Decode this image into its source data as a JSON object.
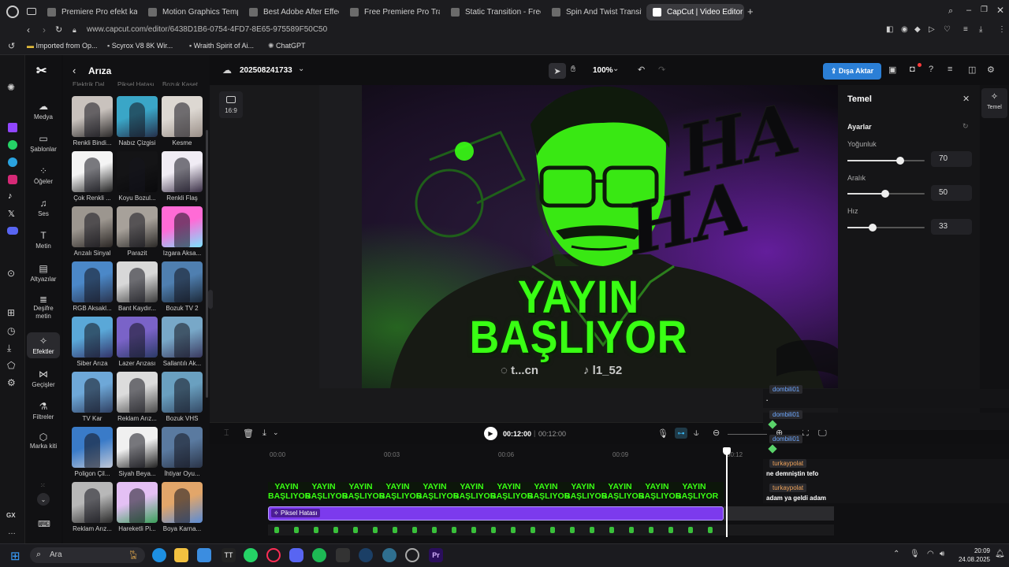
{
  "browser": {
    "tabs": [
      {
        "label": "Premiere Pro efekt kaynak"
      },
      {
        "label": "Motion Graphics Templat"
      },
      {
        "label": "Best Adobe After Effects"
      },
      {
        "label": "Free Premiere Pro Transit"
      },
      {
        "label": "Static Transition - Free P"
      },
      {
        "label": "Spin And Twist Transition"
      },
      {
        "label": "CapCut | Video Editor | Al"
      }
    ],
    "url": "www.capcut.com/editor/6438D1B6-0754-4FD7-8E65-975589F50C50",
    "bookmarks": [
      {
        "label": "Imported from Op..."
      },
      {
        "label": "Scyrox V8 8K Wir..."
      },
      {
        "label": "Wraith Spirit of Ai..."
      },
      {
        "label": "ChatGPT"
      }
    ]
  },
  "nav": {
    "items": [
      {
        "label": "Medya",
        "icon": "cloud-upload-icon"
      },
      {
        "label": "Şablonlar",
        "icon": "template-icon"
      },
      {
        "label": "Öğeler",
        "icon": "elements-icon"
      },
      {
        "label": "Ses",
        "icon": "music-icon"
      },
      {
        "label": "Metin",
        "icon": "text-icon"
      },
      {
        "label": "Altyazılar",
        "icon": "captions-icon"
      },
      {
        "label": "Deşifre metin",
        "icon": "transcript-icon"
      },
      {
        "label": "Efektler",
        "icon": "effects-icon"
      },
      {
        "label": "Geçişler",
        "icon": "transitions-icon"
      },
      {
        "label": "Filtreler",
        "icon": "filters-icon"
      },
      {
        "label": "Marka kiti",
        "icon": "brand-kit-icon"
      }
    ]
  },
  "panel": {
    "title": "Arıza",
    "top_partial_labels": [
      "Elektrik Dal...",
      "Piksel Hatası",
      "Bozuk Kaset"
    ],
    "effects": [
      {
        "label": "Renkli Bindi..."
      },
      {
        "label": "Nabız Çizgisi"
      },
      {
        "label": "Kesme"
      },
      {
        "label": "Çok Renkli ..."
      },
      {
        "label": "Koyu Bozul..."
      },
      {
        "label": "Renkli Flaş"
      },
      {
        "label": "Arızalı Sinyal"
      },
      {
        "label": "Parazit"
      },
      {
        "label": "Izgara Aksa..."
      },
      {
        "label": "RGB Aksakl..."
      },
      {
        "label": "Bant Kaydır..."
      },
      {
        "label": "Bozuk TV 2"
      },
      {
        "label": "Siber Arıza"
      },
      {
        "label": "Lazer Arızası"
      },
      {
        "label": "Sallantılı Ak..."
      },
      {
        "label": "TV Kar"
      },
      {
        "label": "Reklam Arız..."
      },
      {
        "label": "Bozuk VHS"
      },
      {
        "label": "Poligon Çil..."
      },
      {
        "label": "Siyah Beya..."
      },
      {
        "label": "İhtiyar Oyu..."
      },
      {
        "label": "Reklam Arız..."
      },
      {
        "label": "Hareketli Pi..."
      },
      {
        "label": "Boya Karna..."
      }
    ]
  },
  "topbar": {
    "project": "202508241733",
    "zoom": "100%",
    "export": "Dışa Aktar"
  },
  "canvas": {
    "aspect": "16:9",
    "line1": "YAYIN",
    "line2": "BAŞLIYOR",
    "social1": "t...cn",
    "social2": "l1_52",
    "ha": "HA"
  },
  "right_panel": {
    "title": "Temel",
    "tab_label": "Temel",
    "section": "Ayarlar",
    "params": [
      {
        "label": "Yoğunluk",
        "value": 70
      },
      {
        "label": "Aralık",
        "value": 50
      },
      {
        "label": "Hız",
        "value": 33
      }
    ]
  },
  "playback": {
    "current": "00:12:00",
    "total": "00:12:00"
  },
  "timeline": {
    "ticks": [
      "00:00",
      "00:03",
      "00:06",
      "00:09",
      "00:12"
    ],
    "effect_clip": "Piksel Hatası",
    "text_clip_top": "YAYIN",
    "text_clip_bottom": "BAŞLIYOR",
    "playhead_fraction": 0.995
  },
  "chat": [
    {
      "user": "dombili01",
      "msg": "."
    },
    {
      "user": "dombili01",
      "msg": ""
    },
    {
      "user": "dombili01",
      "msg": ""
    },
    {
      "user": "turkaypolat",
      "msg": "ne demniştin tefo"
    },
    {
      "user": "turkaypolat",
      "msg": "adam ya geldi adam"
    }
  ],
  "taskbar": {
    "search": "Ara",
    "time": "20:09",
    "date": "24.08.2025"
  },
  "colors": {
    "accent": "#2b7fd6",
    "neon_green": "#39ff14",
    "effect_clip": "#7c3aed"
  }
}
